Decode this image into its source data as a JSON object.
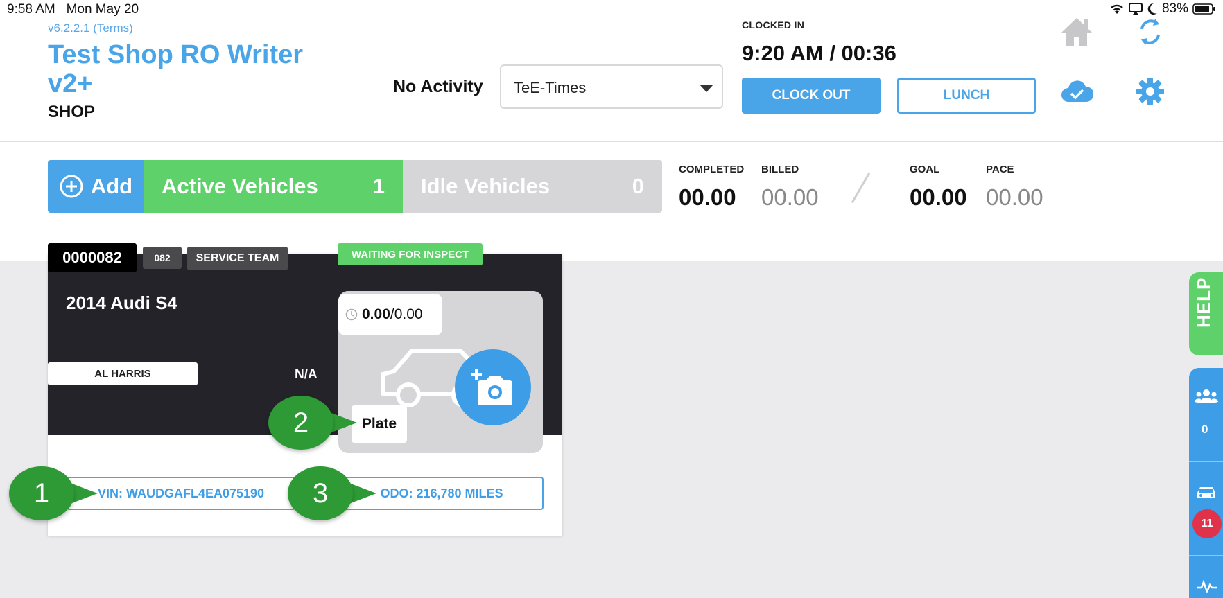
{
  "status_bar": {
    "time": "9:58 AM",
    "date": "Mon May 20",
    "battery": "83%"
  },
  "header": {
    "version": "v6.2.2.1 (Terms)",
    "shop_name": "Test Shop RO Writer v2+",
    "shop_sub": "SHOP",
    "activity_label": "No Activity",
    "activity_select": "TeE-Times",
    "clock_label": "CLOCKED IN",
    "clock_value": "9:20 AM / 00:36",
    "clock_out": "CLOCK OUT",
    "lunch": "LUNCH"
  },
  "toolbar": {
    "add": "Add",
    "active_label": "Active Vehicles",
    "active_count": "1",
    "idle_label": "Idle Vehicles",
    "idle_count": "0",
    "stats": {
      "completed_label": "COMPLETED",
      "completed_value": "00.00",
      "billed_label": "BILLED",
      "billed_value": "00.00",
      "goal_label": "GOAL",
      "goal_value": "00.00",
      "pace_label": "PACE",
      "pace_value": "00.00"
    }
  },
  "card": {
    "ro_number": "0000082",
    "tag_number": "082",
    "team": "SERVICE TEAM",
    "status": "WAITING FOR INSPECT",
    "vehicle": "2014 Audi S4",
    "advisor": "AL HARRIS",
    "na": "N/A",
    "hours_actual": "0.00",
    "hours_total": "/0.00",
    "plate": "Plate",
    "vin": "VIN: WAUDGAFL4EA075190",
    "odo": "ODO: 216,780 MILES"
  },
  "callouts": [
    "1",
    "2",
    "3"
  ],
  "rail": {
    "help": "HELP",
    "team_count": "0",
    "vehicle_badge": "11"
  },
  "colors": {
    "accent": "#4aa5e8",
    "green": "#5fd16a",
    "dark": "#24232a",
    "red": "#e0334b"
  }
}
